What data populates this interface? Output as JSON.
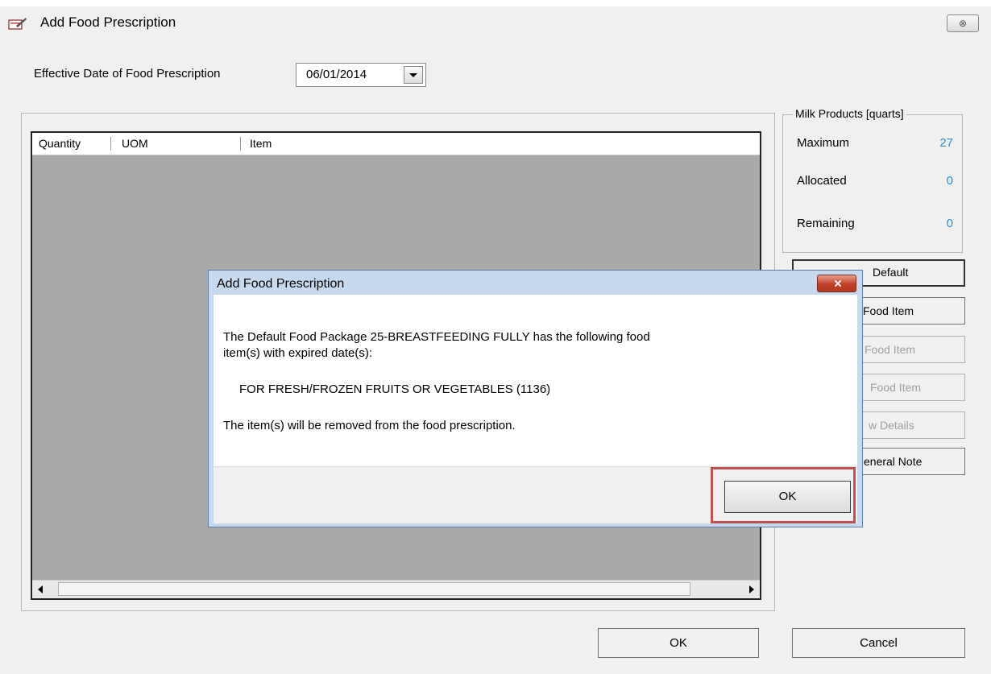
{
  "window": {
    "title": "Add Food Prescription",
    "close_glyph": "⊗"
  },
  "effective_date": {
    "label": "Effective Date of Food Prescription",
    "value": "06/01/2014"
  },
  "grid": {
    "columns": [
      "Quantity",
      "UOM",
      "Item"
    ],
    "rows": []
  },
  "milk_products": {
    "title": "Milk Products [quarts]",
    "rows": [
      {
        "label": "Maximum",
        "value": "27"
      },
      {
        "label": "Allocated",
        "value": "0"
      },
      {
        "label": "Remaining",
        "value": "0"
      }
    ],
    "value_color": "#2a8cd4"
  },
  "side_buttons": {
    "default_label": "Default",
    "add_food_item": "Food Item",
    "edit_food_item": "Food Item",
    "remove_food_item": "Food Item",
    "view_details": "w Details",
    "general_note": "eneral Note"
  },
  "bottom_buttons": {
    "ok": "OK",
    "cancel": "Cancel"
  },
  "modal": {
    "title": "Add Food Prescription",
    "line1": "The Default Food Package 25-BREASTFEEDING FULLY has the following food",
    "line2": "item(s) with expired date(s):",
    "item": "FOR FRESH/FROZEN FRUITS OR VEGETABLES (1136)",
    "line3": "The item(s) will be removed from the food prescription.",
    "ok": "OK",
    "highlight_color": "#c05050"
  }
}
